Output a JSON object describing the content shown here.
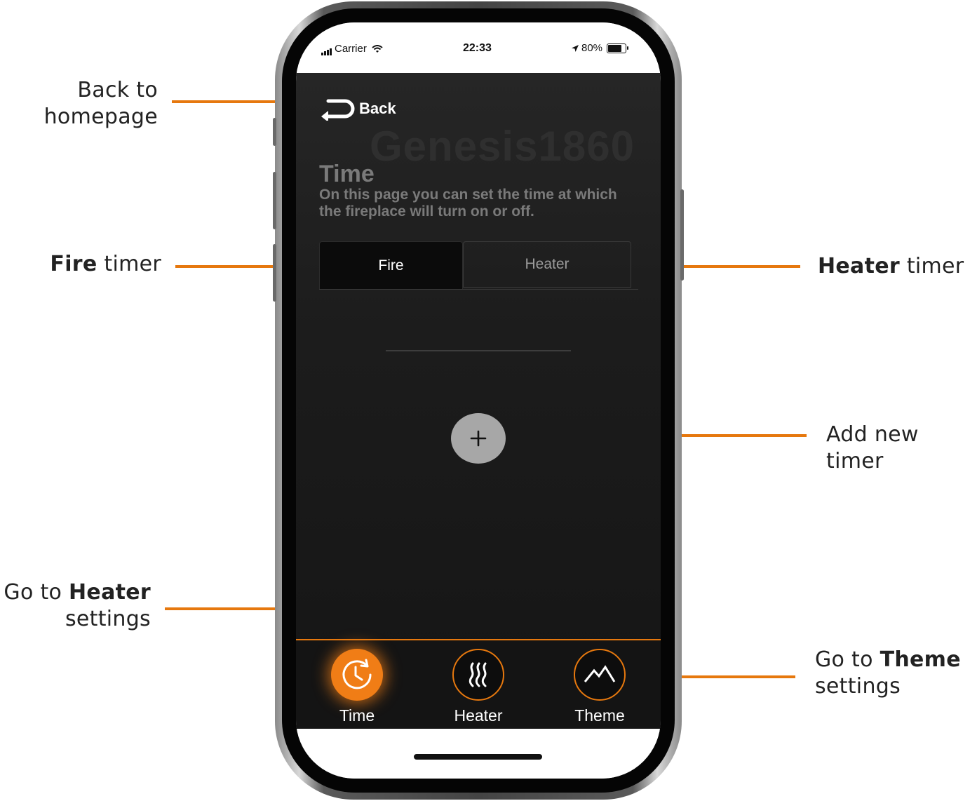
{
  "annotations": {
    "back": {
      "text": "Back to\nhomepage"
    },
    "fire": {
      "bold": "Fire",
      "rest": " timer"
    },
    "heater": {
      "bold": "Heater",
      "rest": " timer"
    },
    "add": {
      "text": "Add new\ntimer"
    },
    "heater_settings": {
      "pre": "Go to ",
      "bold": "Heater",
      "post": "settings"
    },
    "theme_settings": {
      "pre": "Go to ",
      "bold": "Theme",
      "post": "settings"
    },
    "line_color": "#e6780e"
  },
  "status_bar": {
    "carrier": "Carrier",
    "time": "22:33",
    "battery": "80%"
  },
  "app": {
    "back_label": "Back",
    "brand": "Genesis1860",
    "title": "Time",
    "description": "On this page you can set the time at which the fireplace will turn on or off.",
    "tabs": [
      {
        "label": "Fire",
        "active": true
      },
      {
        "label": "Heater",
        "active": false
      }
    ],
    "add_button_symbol": "+",
    "nav": [
      {
        "label": "Time",
        "icon": "clock-icon",
        "active": true
      },
      {
        "label": "Heater",
        "icon": "flame-icon",
        "active": false
      },
      {
        "label": "Theme",
        "icon": "mountain-icon",
        "active": false
      }
    ],
    "accent_color": "#f07d16"
  }
}
